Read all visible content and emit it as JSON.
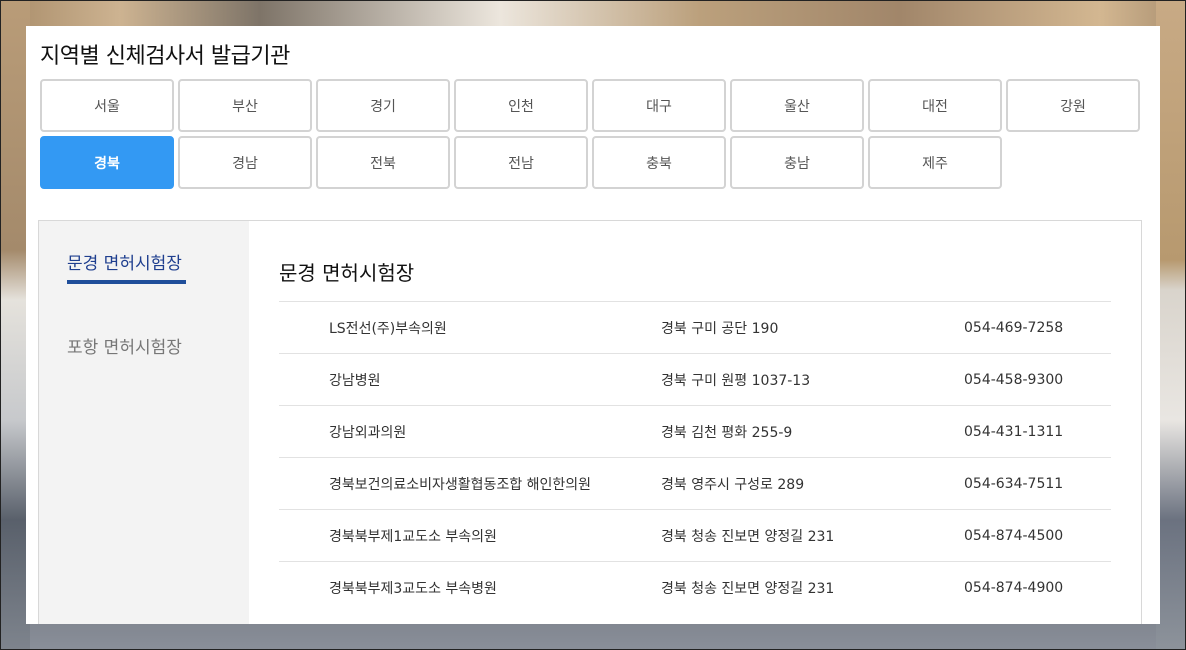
{
  "page": {
    "title": "지역별 신체검사서 발급기관"
  },
  "regions": [
    {
      "label": "서울",
      "active": false
    },
    {
      "label": "부산",
      "active": false
    },
    {
      "label": "경기",
      "active": false
    },
    {
      "label": "인천",
      "active": false
    },
    {
      "label": "대구",
      "active": false
    },
    {
      "label": "울산",
      "active": false
    },
    {
      "label": "대전",
      "active": false
    },
    {
      "label": "강원",
      "active": false
    },
    {
      "label": "경북",
      "active": true
    },
    {
      "label": "경남",
      "active": false
    },
    {
      "label": "전북",
      "active": false
    },
    {
      "label": "전남",
      "active": false
    },
    {
      "label": "충북",
      "active": false
    },
    {
      "label": "충남",
      "active": false
    },
    {
      "label": "제주",
      "active": false
    }
  ],
  "side_nav": {
    "items": [
      {
        "label": "문경 면허시험장",
        "active": true
      },
      {
        "label": "포항 면허시험장",
        "active": false
      }
    ]
  },
  "main": {
    "section_title": "문경 면허시험장",
    "rows": [
      {
        "name": "LS전선(주)부속의원",
        "address": "경북 구미 공단 190",
        "phone": "054-469-7258"
      },
      {
        "name": "강남병원",
        "address": "경북 구미 원평 1037-13",
        "phone": "054-458-9300"
      },
      {
        "name": "강남외과의원",
        "address": "경북 김천 평화 255-9",
        "phone": "054-431-1311"
      },
      {
        "name": "경북보건의료소비자생활협동조합 해인한의원",
        "address": "경북 영주시 구성로 289",
        "phone": "054-634-7511"
      },
      {
        "name": "경북북부제1교도소 부속의원",
        "address": "경북 청송 진보면 양정길 231",
        "phone": "054-874-4500"
      },
      {
        "name": "경북북부제3교도소 부속병원",
        "address": "경북 청송 진보면 양정길 231",
        "phone": "054-874-4900"
      }
    ]
  },
  "colors": {
    "active_region": "#3399f3",
    "active_tab_underline": "#1f4e9a",
    "active_tab_text": "#1f3f8f"
  }
}
